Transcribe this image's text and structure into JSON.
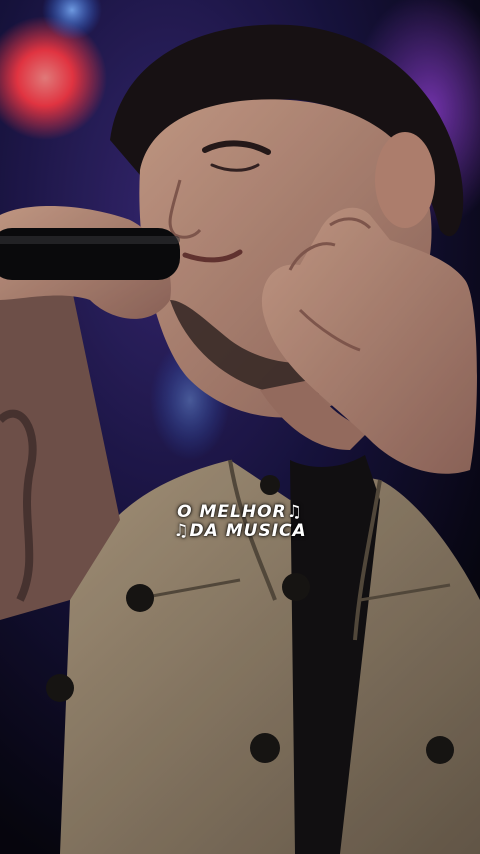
{
  "caption": {
    "line1": "O MELHOR♫",
    "line2": "♫DA MUSICA"
  },
  "colors": {
    "backdrop_dark": "#0d0b1c",
    "stage_light_red": "#ff3b4a",
    "stage_light_blue": "#2b6dff",
    "jacket_beige": "#a89478",
    "skin": "#c99a84",
    "text": "#ffffff"
  }
}
